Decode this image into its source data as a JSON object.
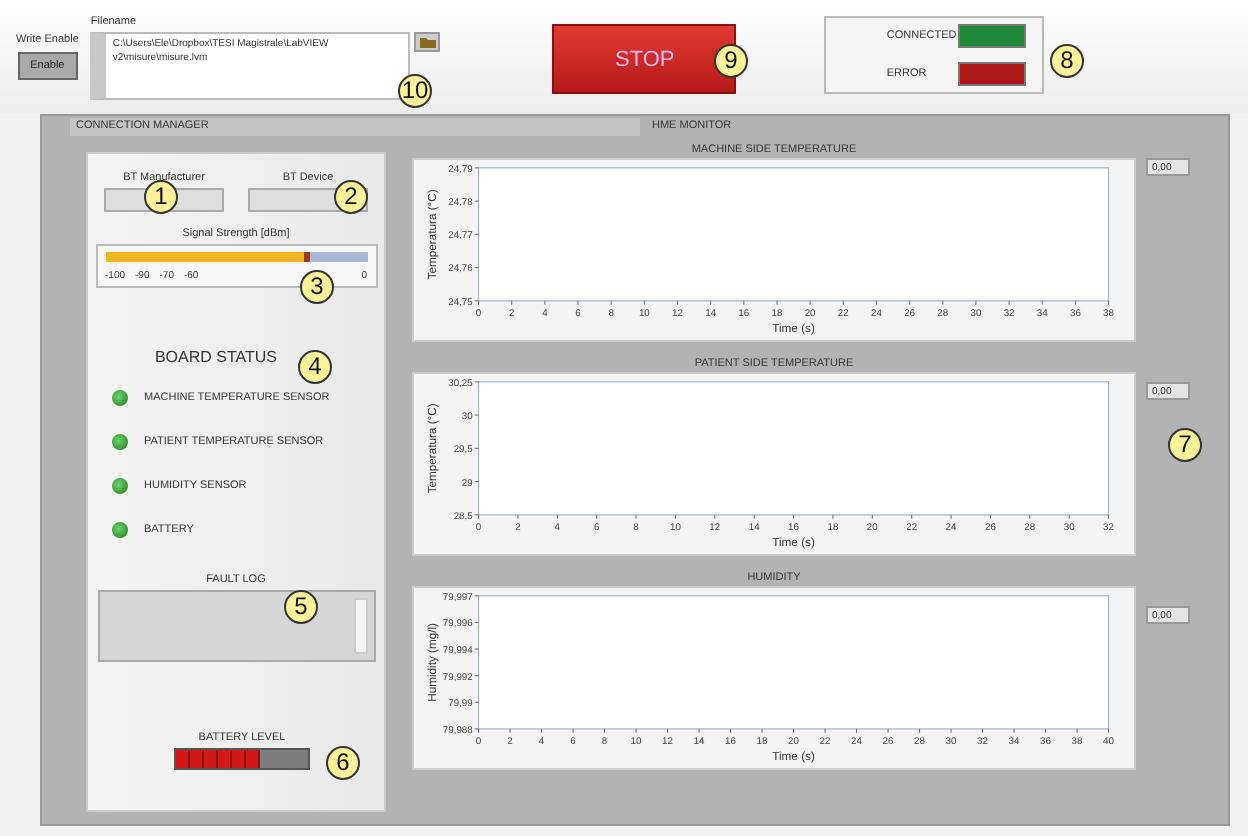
{
  "write_enable": {
    "label": "Write Enable",
    "button": "Enable"
  },
  "filename": {
    "label": "Filename",
    "value": "C:\\Users\\Ele\\Dropbox\\TESI Magistrale\\LabVIEW v2\\misure\\misure.lvm"
  },
  "stop_button": "STOP",
  "status_indicators": [
    {
      "label": "CONNECTED",
      "color": "#1f8a3a"
    },
    {
      "label": "ERROR",
      "color": "#b01818"
    }
  ],
  "sections": [
    "CONNECTION MANAGER",
    "HME MONITOR"
  ],
  "connection_manager": {
    "bt_manufacturer": {
      "label": "BT Manufacturer"
    },
    "bt_device": {
      "label": "BT Device"
    },
    "signal_strength": {
      "label": "Signal Strength [dBm]",
      "level": 0.78,
      "scale": [
        "-100",
        "-90",
        "-70",
        "-60",
        "0"
      ]
    },
    "board_status": {
      "title": "BOARD STATUS",
      "sensors": [
        {
          "label": "MACHINE TEMPERATURE SENSOR",
          "on": true
        },
        {
          "label": "PATIENT TEMPERATURE SENSOR",
          "on": true
        },
        {
          "label": "HUMIDITY SENSOR",
          "on": true
        },
        {
          "label": "BATTERY",
          "on": true
        }
      ]
    },
    "fault_log": {
      "label": "FAULT LOG"
    },
    "battery": {
      "label": "BATTERY LEVEL",
      "level": 0.63
    }
  },
  "charts": [
    {
      "value": "0,00",
      "title": "MACHINE SIDE TEMPERATURE",
      "xlabel": "Time (s)",
      "ylabel": "Temperatura (°C)",
      "x_ticks": [
        "0",
        "2",
        "4",
        "6",
        "8",
        "10",
        "12",
        "14",
        "16",
        "18",
        "20",
        "22",
        "24",
        "26",
        "28",
        "30",
        "32",
        "34",
        "36",
        "38"
      ],
      "y_ticks": [
        "24,79",
        "24,78",
        "24,77",
        "24,76",
        "24,75"
      ]
    },
    {
      "value": "0,00",
      "title": "PATIENT SIDE TEMPERATURE",
      "xlabel": "Time (s)",
      "ylabel": "Temperatura (°C)",
      "x_ticks": [
        "0",
        "2",
        "4",
        "6",
        "8",
        "10",
        "12",
        "14",
        "16",
        "18",
        "20",
        "22",
        "24",
        "26",
        "28",
        "30",
        "32"
      ],
      "y_ticks": [
        "30,25",
        "30",
        "29,5",
        "29",
        "28,5"
      ]
    },
    {
      "value": "0,00",
      "title": "HUMIDITY",
      "xlabel": "Time (s)",
      "ylabel": "Humidity (mg/l)",
      "x_ticks": [
        "0",
        "2",
        "4",
        "6",
        "8",
        "10",
        "12",
        "14",
        "16",
        "18",
        "20",
        "22",
        "24",
        "26",
        "28",
        "30",
        "32",
        "34",
        "36",
        "38",
        "40"
      ],
      "y_ticks": [
        "79,997",
        "79,996",
        "79,994",
        "79,992",
        "79,99",
        "79,988"
      ]
    }
  ],
  "callouts": [
    "1",
    "2",
    "3",
    "4",
    "5",
    "6",
    "7",
    "8",
    "9",
    "10"
  ]
}
